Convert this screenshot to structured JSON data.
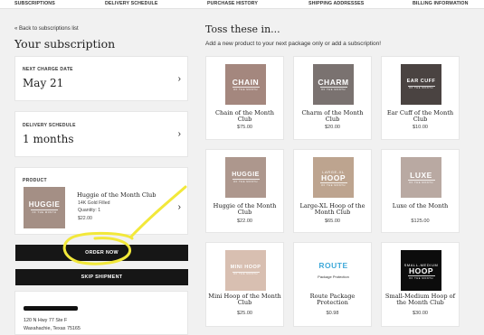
{
  "nav": [
    "SUBSCRIPTIONS",
    "DELIVERY SCHEDULE",
    "PURCHASE HISTORY",
    "SHIPPING ADDRESSES",
    "BILLING INFORMATION"
  ],
  "back_link": "Back to subscriptions list",
  "page_title": "Your subscription",
  "next_charge": {
    "label": "NEXT CHARGE DATE",
    "value": "May 21"
  },
  "delivery": {
    "label": "DELIVERY SCHEDULE",
    "value": "1 months"
  },
  "product": {
    "label": "PRODUCT",
    "thumb_title": "HUGGIE",
    "thumb_sub": "OF THE MONTH",
    "name": "Huggie of the Month Club",
    "variant": "14K Gold Filled",
    "quantity": "Quantity: 1",
    "price": "$22.00"
  },
  "buttons": {
    "order_now": "ORDER NOW",
    "skip": "SKIP SHIPMENT"
  },
  "address": {
    "line1": "120 N Hwy 77 Ste F",
    "line2": "Waxahachie, Texas 75165"
  },
  "toss": {
    "title": "Toss these in...",
    "subtitle": "Add a new product to your next package only or add a subscription!",
    "products": [
      {
        "name": "Chain of the Month Club",
        "price": "$75.00",
        "thumb_title": "CHAIN",
        "thumb_sub": "OF THE MONTH",
        "bg": "#a4877e",
        "fg": "#ffffff"
      },
      {
        "name": "Charm of the Month Club",
        "price": "$20.00",
        "thumb_title": "CHARM",
        "thumb_sub": "OF THE MONTH",
        "bg": "#7a7270",
        "fg": "#ffffff"
      },
      {
        "name": "Ear Cuff of the Month Club",
        "price": "$10.00",
        "thumb_title": "EAR CUFF",
        "thumb_sub": "OF THE MONTH",
        "bg": "#4a4341",
        "fg": "#ffffff"
      },
      {
        "name": "Huggie of the Month Club",
        "price": "$22.00",
        "thumb_title": "HUGGIE",
        "thumb_sub": "OF THE MONTH",
        "bg": "#ad978d",
        "fg": "#ffffff"
      },
      {
        "name": "Large-XL Hoop of the Month Club",
        "price": "$65.00",
        "thumb_title": "HOOP",
        "thumb_pre": "LARGE-XL",
        "thumb_sub": "OF THE MONTH",
        "bg": "#bda48f",
        "fg": "#ffffff"
      },
      {
        "name": "Luxe of the Month",
        "price": "$125.00",
        "thumb_title": "LUXE",
        "thumb_sub": "OF THE MONTH",
        "bg": "#b9a9a2",
        "fg": "#ffffff"
      },
      {
        "name": "Mini Hoop of the Month Club",
        "price": "$25.00",
        "thumb_title": "MINI HOOP",
        "thumb_sub": "OF THE MONTH",
        "bg": "#d8bfb1",
        "fg": "#ffffff"
      },
      {
        "name": "Route Package Protection",
        "price": "$0.98",
        "thumb_title": "ROUTE",
        "thumb_sub": "Package Protection",
        "bg": "#ffffff",
        "fg": "#3fa9d9"
      },
      {
        "name": "Small-Medium Hoop of the Month Club",
        "price": "$30.00",
        "thumb_title": "HOOP",
        "thumb_pre": "SMALL-MEDIUM",
        "thumb_sub": "OF THE MONTH",
        "bg": "#0c0c0c",
        "fg": "#ffffff"
      }
    ]
  },
  "annotation_color": "#f2e83a"
}
